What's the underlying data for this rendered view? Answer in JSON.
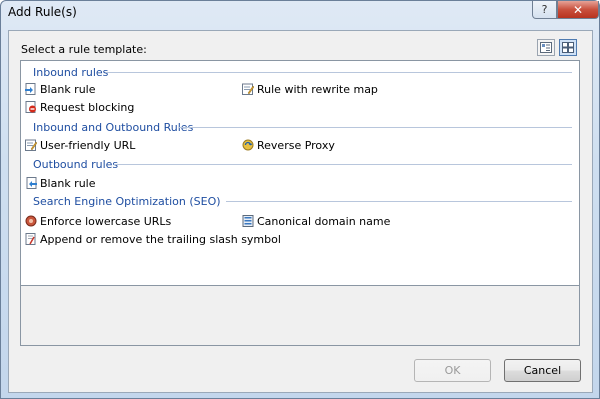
{
  "window": {
    "title": "Add Rule(s)",
    "help_label": "?",
    "close_label": "✕"
  },
  "select_label": "Select a rule template:",
  "view_buttons": {
    "details_icon": "details-view-icon",
    "tiles_icon": "tiles-view-icon",
    "active": "tiles"
  },
  "groups": [
    {
      "header": "Inbound rules",
      "items": [
        {
          "label": "Blank rule",
          "icon": "inbound-rule-icon"
        },
        {
          "label": "Rule with rewrite map",
          "icon": "rewrite-map-icon"
        },
        {
          "label": "Request blocking",
          "icon": "request-blocking-icon"
        }
      ]
    },
    {
      "header": "Inbound and Outbound Rules",
      "items": [
        {
          "label": "User-friendly URL",
          "icon": "user-friendly-url-icon"
        },
        {
          "label": "Reverse Proxy",
          "icon": "reverse-proxy-icon"
        }
      ]
    },
    {
      "header": "Outbound rules",
      "items": [
        {
          "label": "Blank rule",
          "icon": "outbound-rule-icon"
        }
      ]
    },
    {
      "header": "Search Engine Optimization (SEO)",
      "items": [
        {
          "label": "Enforce lowercase URLs",
          "icon": "lowercase-urls-icon"
        },
        {
          "label": "Canonical domain name",
          "icon": "canonical-domain-icon"
        },
        {
          "label": "Append or remove the trailing slash symbol",
          "icon": "trailing-slash-icon"
        }
      ]
    }
  ],
  "buttons": {
    "ok": "OK",
    "cancel": "Cancel"
  },
  "colors": {
    "group_header": "#1f4ea1",
    "close_button": "#c9503d"
  }
}
